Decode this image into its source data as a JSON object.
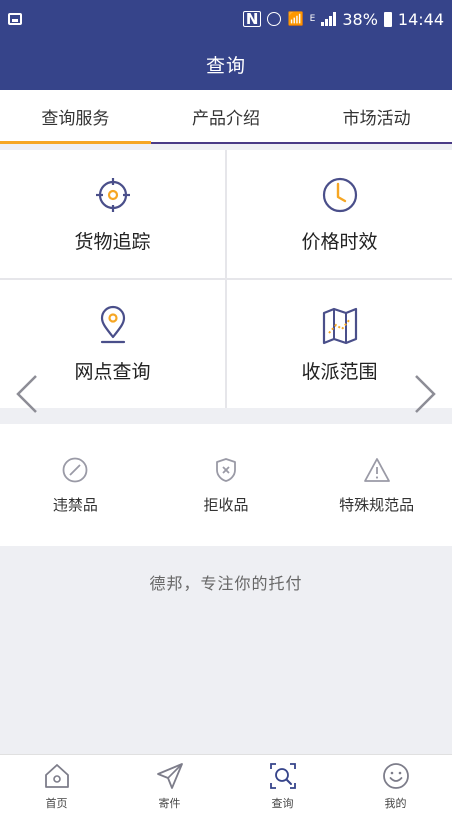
{
  "status_bar": {
    "battery": "38%",
    "time": "14:44",
    "network": "E"
  },
  "header": {
    "title": "查询"
  },
  "tabs": [
    {
      "label": "查询服务",
      "active": true
    },
    {
      "label": "产品介绍",
      "active": false
    },
    {
      "label": "市场活动",
      "active": false
    }
  ],
  "services": [
    {
      "label": "货物追踪",
      "icon": "crosshair-icon"
    },
    {
      "label": "价格时效",
      "icon": "clock-icon"
    },
    {
      "label": "网点查询",
      "icon": "location-pin-icon"
    },
    {
      "label": "收派范围",
      "icon": "map-icon"
    }
  ],
  "restrictions": [
    {
      "label": "违禁品",
      "icon": "prohibited-icon"
    },
    {
      "label": "拒收品",
      "icon": "shield-x-icon"
    },
    {
      "label": "特殊规范品",
      "icon": "warning-icon"
    }
  ],
  "slogan": "德邦，专注你的托付",
  "bottom_nav": [
    {
      "label": "首页",
      "icon": "home-icon"
    },
    {
      "label": "寄件",
      "icon": "send-icon"
    },
    {
      "label": "查询",
      "icon": "search-icon"
    },
    {
      "label": "我的",
      "icon": "smiley-icon"
    }
  ],
  "colors": {
    "primary": "#36448a",
    "accent": "#f6a623",
    "icon_stroke": "#4a4f8a"
  }
}
